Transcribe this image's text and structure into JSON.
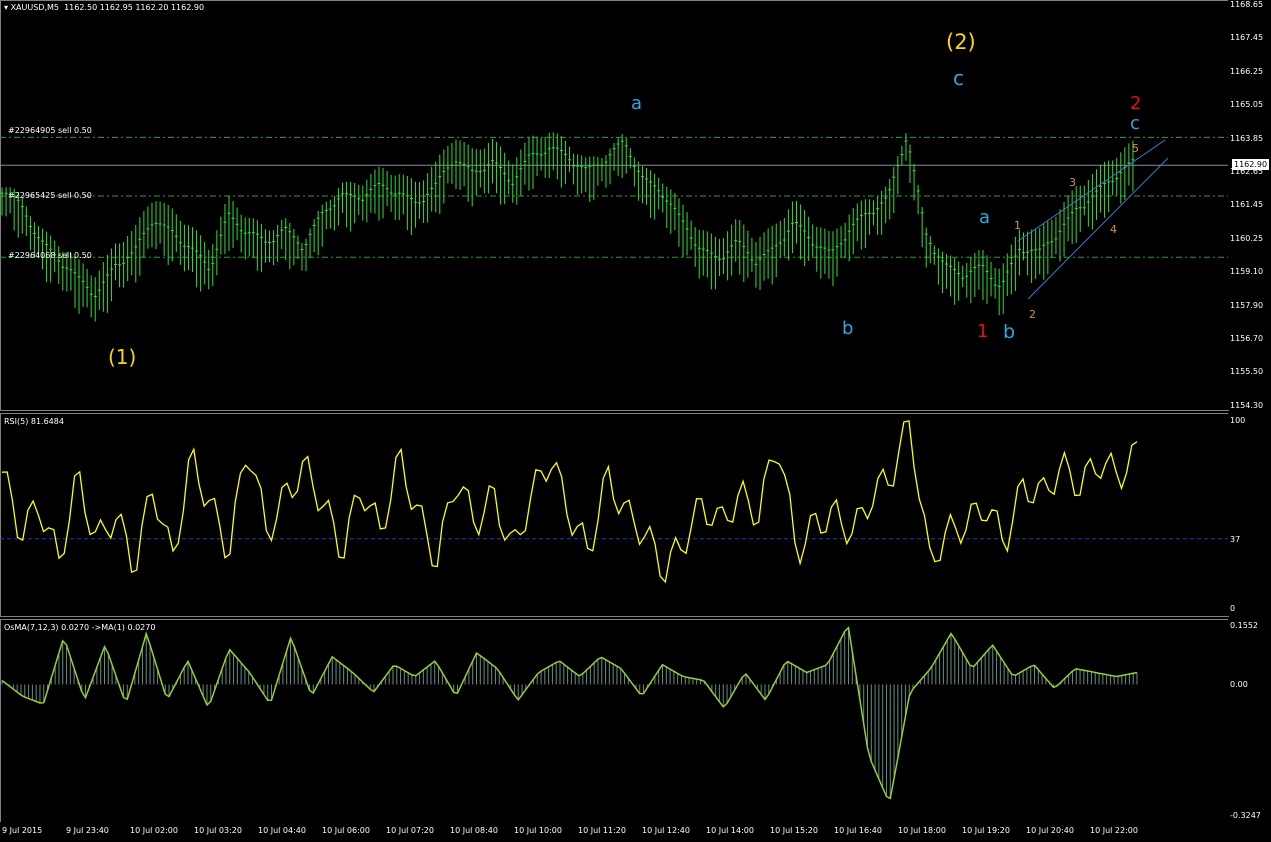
{
  "header": {
    "symbol": "XAUUSD,M5",
    "ohlc": "1162.50 1162.95 1162.20 1162.90"
  },
  "price_axis": {
    "ticks": [
      "1168.65",
      "1167.45",
      "1166.25",
      "1165.05",
      "1163.85",
      "1162.65",
      "1161.45",
      "1160.25",
      "1159.10",
      "1157.90",
      "1156.70",
      "1155.50",
      "1154.30"
    ],
    "current": "1162.90"
  },
  "orders": [
    {
      "label": "#22964905 sell 0.50",
      "price": 1163.9
    },
    {
      "label": "#22965425 sell 0.50",
      "price": 1161.8
    },
    {
      "label": "#22964068 sell 0.50",
      "price": 1159.6
    }
  ],
  "waves": [
    {
      "text": "(1)",
      "color": "#ffd700"
    },
    {
      "text": "a",
      "color": "#29a8e0"
    },
    {
      "text": "b",
      "color": "#29a8e0"
    },
    {
      "text": "(2)",
      "color": "#ffd700"
    },
    {
      "text": "c",
      "color": "#29a8e0"
    },
    {
      "text": "a",
      "color": "#29a8e0"
    },
    {
      "text": "1",
      "color": "#e81010"
    },
    {
      "text": "b",
      "color": "#29a8e0"
    },
    {
      "text": "2",
      "color": "#e81010"
    },
    {
      "text": "c",
      "color": "#29a8e0"
    },
    {
      "text": "1",
      "color": "#d8913a"
    },
    {
      "text": "2",
      "color": "#d8913a"
    },
    {
      "text": "3",
      "color": "#d8913a"
    },
    {
      "text": "4",
      "color": "#d8913a"
    },
    {
      "text": "5",
      "color": "#d8913a"
    }
  ],
  "rsi": {
    "label": "RSI(5) 81.6484",
    "ticks": [
      "100",
      "37",
      "0"
    ]
  },
  "osma": {
    "label": "OsMA(7,12,3) 0.0270  ->MA(1) 0.0270",
    "ticks": [
      "0.1552",
      "0.00",
      "-0.3247"
    ]
  },
  "time_axis": [
    "9 Jul 2015",
    "9 Jul 23:40",
    "10 Jul 02:00",
    "10 Jul 03:20",
    "10 Jul 04:40",
    "10 Jul 06:00",
    "10 Jul 07:20",
    "10 Jul 08:40",
    "10 Jul 10:00",
    "10 Jul 11:20",
    "10 Jul 12:40",
    "10 Jul 14:00",
    "10 Jul 15:20",
    "10 Jul 16:40",
    "10 Jul 18:00",
    "10 Jul 19:20",
    "10 Jul 20:40",
    "10 Jul 22:00"
  ],
  "chart_data": {
    "type": "line",
    "title": "XAUUSD,M5",
    "series": [
      {
        "name": "XAUUSD,M5",
        "values": [
          1161.9,
          1161.2,
          1160.1,
          1159.4,
          1158.6,
          1158.1,
          1159.2,
          1159.5,
          1160.8,
          1160.4,
          1159.7,
          1159.0,
          1161.0,
          1160.3,
          1159.9,
          1160.5,
          1159.8,
          1160.9,
          1161.7,
          1161.6,
          1161.9,
          1161.8,
          1161.4,
          1161.9,
          1163.0,
          1162.5,
          1162.8,
          1162.1,
          1163.1,
          1163.3,
          1163.0,
          1162.6,
          1162.9,
          1163.5,
          1162.3,
          1161.8,
          1160.7,
          1159.8,
          1159.4,
          1159.9,
          1159.3,
          1159.8,
          1160.6,
          1160.0,
          1159.6,
          1160.4,
          1161.0,
          1161.6,
          1163.8,
          1160.2,
          1159.2,
          1158.8,
          1159.0,
          1158.4,
          1159.8,
          1159.5,
          1160.3,
          1161.2,
          1161.6,
          1162.3,
          1162.9
        ]
      },
      {
        "name": "RSI(5)",
        "values": [
          72,
          40,
          55,
          25,
          70,
          35,
          50,
          22,
          65,
          25,
          80,
          55,
          30,
          88,
          40,
          60,
          75,
          55,
          30,
          65,
          40,
          80,
          50,
          25,
          70,
          45,
          60,
          30,
          60,
          80,
          50,
          30,
          70,
          50,
          40,
          20,
          35,
          55,
          45,
          60,
          50,
          90,
          30,
          45,
          50,
          40,
          60,
          70,
          99,
          25,
          40,
          45,
          55,
          35,
          65,
          60,
          75,
          65,
          78,
          70,
          82
        ]
      },
      {
        "name": "OsMA(7,12,3)",
        "values": [
          0.01,
          -0.03,
          -0.05,
          0.12,
          -0.04,
          0.1,
          -0.05,
          0.13,
          -0.04,
          0.06,
          -0.06,
          0.09,
          0.03,
          -0.05,
          0.12,
          -0.03,
          0.07,
          0.03,
          -0.02,
          0.05,
          0.02,
          0.06,
          -0.03,
          0.08,
          0.04,
          -0.04,
          0.03,
          0.06,
          0.02,
          0.07,
          0.04,
          -0.03,
          0.05,
          0.02,
          0.01,
          -0.06,
          0.03,
          -0.04,
          0.06,
          0.03,
          0.05,
          0.15,
          -0.18,
          -0.3,
          -0.02,
          0.04,
          0.13,
          0.04,
          0.1,
          0.02,
          0.05,
          -0.01,
          0.04,
          0.03,
          0.02,
          0.03
        ]
      }
    ],
    "ylim": [
      1154.3,
      1168.65
    ],
    "rsi_levels": [
      37
    ],
    "rsi_ylim": [
      0,
      100
    ],
    "osma_ylim": [
      -0.3247,
      0.1552
    ]
  }
}
